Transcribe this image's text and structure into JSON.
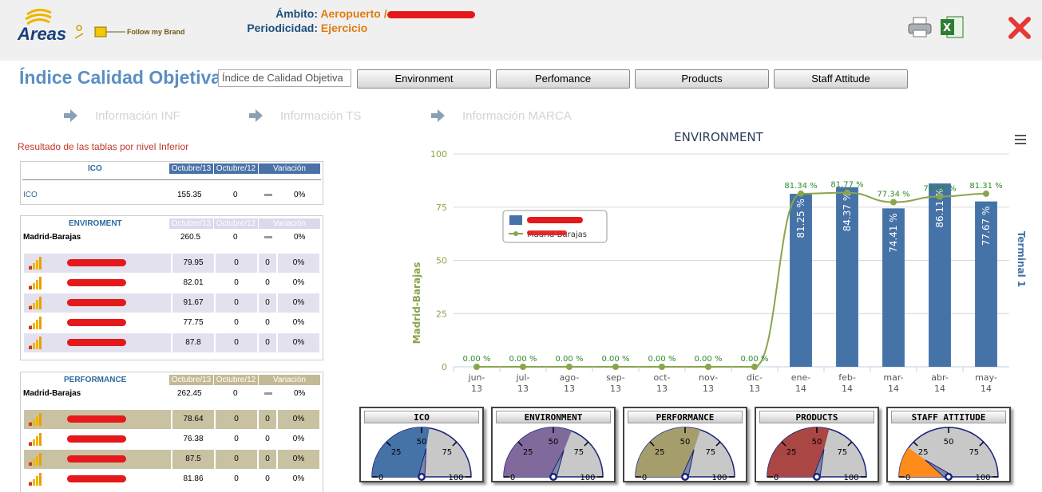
{
  "header": {
    "logo_text": "Areas",
    "brand_text": "Follow my Brand",
    "ambito_label": "Ámbito:",
    "ambito_value": "Aeropuerto /",
    "periodicidad_label": "Periodicidad:",
    "periodicidad_value": "Ejercicio",
    "print_icon": "printer-icon",
    "excel_icon": "excel-icon",
    "close_icon": "close-icon"
  },
  "toolbar": {
    "title": "Índice Calidad Objetiva",
    "select_value": "Índice de Calidad Objetiva",
    "tabs": [
      "Environment",
      "Perfomance",
      "Products",
      "Staff Attitude"
    ]
  },
  "info_links": [
    "Información INF",
    "Información TS",
    "Información MARCA"
  ],
  "results_caption": "Resultado de las tablas por nivel Inferior",
  "tables": {
    "ico": {
      "name": "ICO",
      "cols": [
        "Octubre/13",
        "Octubre/12",
        "Variación"
      ],
      "row_label": "ICO",
      "row_vals": [
        "155.35",
        "0",
        "0%"
      ]
    },
    "environment": {
      "name": "ENVIROMENT",
      "cols": [
        "Octubre/13",
        "Octubre/12",
        "Variación"
      ],
      "row_label": "Madrid-Barajas",
      "row_vals": [
        "260.5",
        "0",
        "0%"
      ],
      "items": [
        {
          "v1": "79.95",
          "v2": "0",
          "v3": "0",
          "v4": "0%"
        },
        {
          "v1": "82.01",
          "v2": "0",
          "v3": "0",
          "v4": "0%"
        },
        {
          "v1": "91.67",
          "v2": "0",
          "v3": "0",
          "v4": "0%"
        },
        {
          "v1": "77.75",
          "v2": "0",
          "v3": "0",
          "v4": "0%"
        },
        {
          "v1": "87.8",
          "v2": "0",
          "v3": "0",
          "v4": "0%"
        }
      ]
    },
    "performance": {
      "name": "PERFORMANCE",
      "cols": [
        "Octubre/13",
        "Octubre/12",
        "Variación"
      ],
      "row_label": "Madrid-Barajas",
      "row_vals": [
        "262.45",
        "0",
        "0%"
      ],
      "items": [
        {
          "v1": "78.64",
          "v2": "0",
          "v3": "0",
          "v4": "0%"
        },
        {
          "v1": "76.38",
          "v2": "0",
          "v3": "0",
          "v4": "0%"
        },
        {
          "v1": "87.5",
          "v2": "0",
          "v3": "0",
          "v4": "0%"
        },
        {
          "v1": "81.86",
          "v2": "0",
          "v3": "0",
          "v4": "0%"
        }
      ]
    }
  },
  "chart_data": {
    "type": "bar",
    "title": "ENVIRONMENT",
    "ylabel_left": "Madrid-Barajas",
    "ylabel_right": "Terminal 1",
    "ylim": [
      0,
      100
    ],
    "yticks": [
      0,
      25,
      50,
      75,
      100
    ],
    "categories": [
      [
        "jun-",
        "13"
      ],
      [
        "jul-",
        "13"
      ],
      [
        "ago-",
        "13"
      ],
      [
        "sep-",
        "13"
      ],
      [
        "oct-",
        "13"
      ],
      [
        "nov-",
        "13"
      ],
      [
        "dic-",
        "13"
      ],
      [
        "ene-",
        "14"
      ],
      [
        "feb-",
        "14"
      ],
      [
        "mar-",
        "14"
      ],
      [
        "abr-",
        "14"
      ],
      [
        "may-",
        "14"
      ]
    ],
    "bars": [
      null,
      null,
      null,
      null,
      null,
      null,
      null,
      81.25,
      84.37,
      74.41,
      86.11,
      77.67
    ],
    "bar_labels": [
      "",
      "",
      "",
      "",
      "",
      "",
      "",
      "81.25 %",
      "84.37 %",
      "74.41 %",
      "86.11 %",
      "77.67 %"
    ],
    "line": [
      0,
      0,
      0,
      0,
      0,
      0,
      0,
      81.34,
      81.77,
      77.34,
      79.96,
      81.31
    ],
    "line_labels": [
      "0.00 %",
      "0.00 %",
      "0.00 %",
      "0.00 %",
      "0.00 %",
      "0.00 %",
      "0.00 %",
      "81.34 %",
      "81.77 %",
      "77.34 %",
      "79.96 %",
      "81.31 %"
    ],
    "legend_line_label": "jas",
    "bar_color": "#4572a7",
    "line_color": "#89a54e",
    "grid": true,
    "legend_placement": "upper-left"
  },
  "gauges": [
    {
      "title": "ICO",
      "value": 55,
      "color": "#4572a7"
    },
    {
      "title": "ENVIRONMENT",
      "value": 62,
      "color": "#80699b"
    },
    {
      "title": "PERFORMANCE",
      "value": 60,
      "color": "#a59e6c"
    },
    {
      "title": "PRODUCTS",
      "value": 58,
      "color": "#aa4643"
    },
    {
      "title": "STAFF ATTITUDE",
      "value": 20,
      "color": "#ff8c1a"
    }
  ],
  "gauge_ticks": [
    "0",
    "25",
    "50",
    "75",
    "100"
  ]
}
